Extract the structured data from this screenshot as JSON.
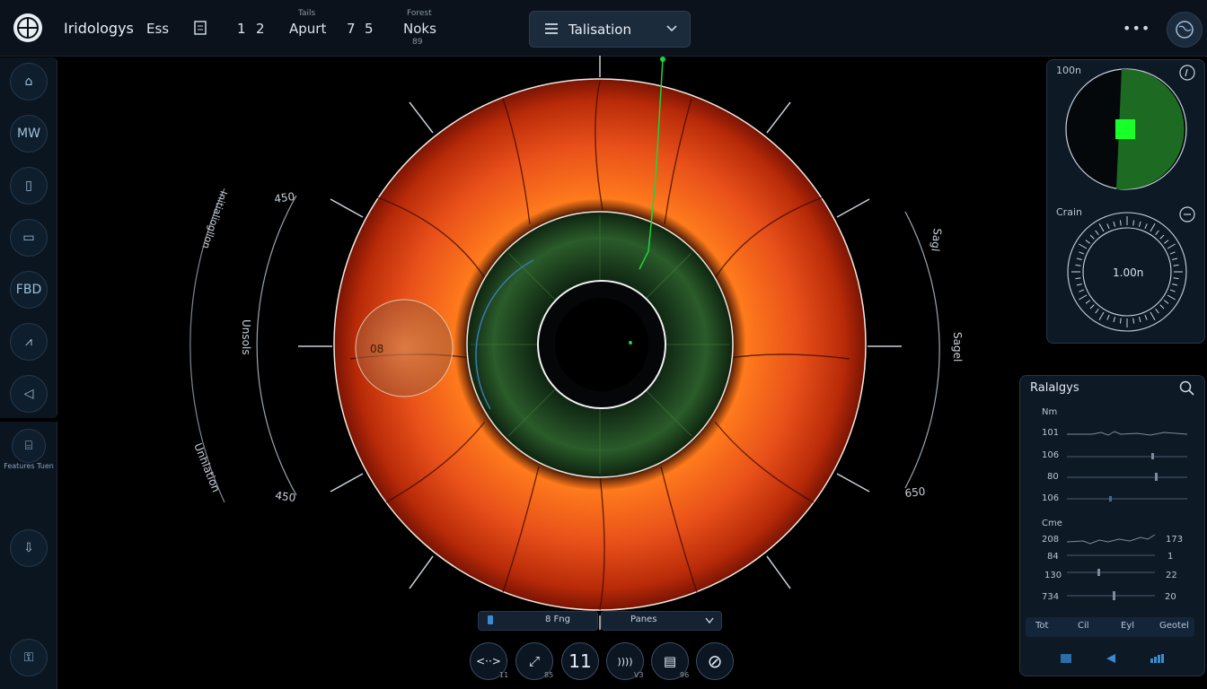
{
  "app": {
    "title": "Iridologys"
  },
  "topbar": {
    "ess": "Ess",
    "num1": "1",
    "num2": "2",
    "apurt_small": "Tails",
    "apurt": "Apurt",
    "num3": "7",
    "num4": "5",
    "noks_small": "Forest",
    "noks": "Noks",
    "noks_sub": "89",
    "dropdown_label": "Talisation",
    "more": "•••"
  },
  "sidebar": {
    "items": [
      {
        "label": "⌂",
        "icon": "home-icon"
      },
      {
        "label": "MW",
        "icon": "mw-icon"
      },
      {
        "label": "▯",
        "icon": "capsule-icon"
      },
      {
        "label": "▭",
        "icon": "screen-icon"
      },
      {
        "label": "FBD",
        "icon": "fbd-icon"
      },
      {
        "label": "⩘",
        "icon": "wave-icon"
      },
      {
        "label": "◁",
        "icon": "speaker-icon"
      }
    ],
    "feature_caption": "Features Tuen",
    "low_items": [
      {
        "label": "⇩",
        "icon": "download-icon"
      },
      {
        "label": "⚿",
        "icon": "lock-icon"
      }
    ]
  },
  "iris": {
    "arc_left_top": "Initialiogllon",
    "arc_left_mid": "Unsols",
    "arc_left_bot": "Unhlation",
    "num_left_top": "450",
    "num_left_bot": "450",
    "num_right_bot": "650",
    "arc_right_top": "Sagl",
    "arc_right_mid": "Sagel",
    "magnifier_label": "08"
  },
  "panel_top": {
    "title": "100n",
    "radar_level": 0.7,
    "dial_title": "Crain",
    "dial_value": "1.00n"
  },
  "panel_bot": {
    "title": "Ralalgys",
    "group1_title": "Nm",
    "group1_rows": [
      {
        "label": "101",
        "value": ""
      },
      {
        "label": "106",
        "value": ""
      },
      {
        "label": "80",
        "value": ""
      },
      {
        "label": "106",
        "value": ""
      }
    ],
    "group2_title": "Cme",
    "group2_rows": [
      {
        "label": "208",
        "value": "173"
      },
      {
        "label": "84",
        "value": "1"
      },
      {
        "label": "130",
        "value": "22"
      },
      {
        "label": "734",
        "value": "20"
      }
    ],
    "tabs": [
      "Tot",
      "Cil",
      "Eyl",
      "Geotel"
    ]
  },
  "bottom": {
    "field_left": "8 Fng",
    "field_right": "Panes",
    "tools": [
      {
        "label": "<··>",
        "sub": "11",
        "icon": "range-icon"
      },
      {
        "label": "⤢",
        "sub": "85",
        "icon": "expand-icon"
      },
      {
        "label": "11",
        "sub": "",
        "icon": "pause-icon"
      },
      {
        "label": "))))",
        "sub": "V3",
        "icon": "wave-icon"
      },
      {
        "label": "▤",
        "sub": "96",
        "icon": "clipboard-icon"
      },
      {
        "label": "⊘",
        "sub": "",
        "icon": "block-icon"
      }
    ]
  },
  "colors": {
    "iris_outer": "#8c1a04",
    "iris_mid": "#e85a15",
    "pupil_ring": "#1f4a25",
    "accent_green": "#19d63a",
    "panel_bg": "#0d1925"
  }
}
